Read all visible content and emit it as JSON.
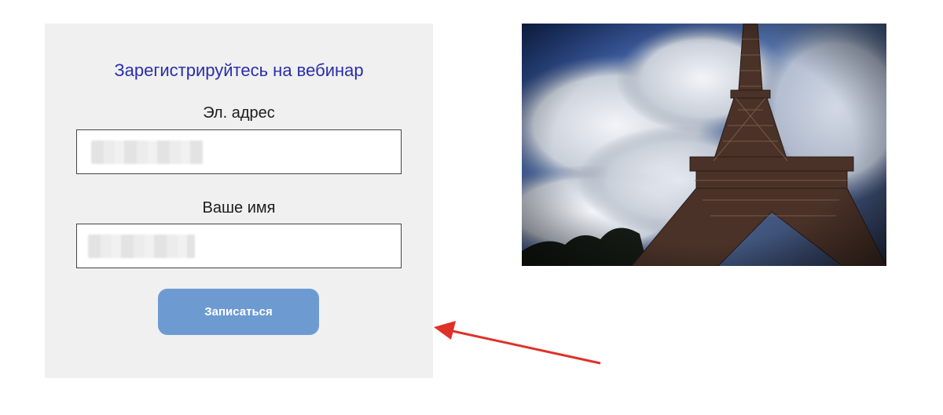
{
  "form": {
    "title": "Зарегистрируйтесь на вебинар",
    "email_label": "Эл. адрес",
    "name_label": "Ваше имя",
    "submit_label": "Записаться"
  },
  "image": {
    "subject": "eiffel-tower-photo"
  },
  "colors": {
    "title": "#2b2ea8",
    "button": "#6d9bd1",
    "panel": "#f0f0f1",
    "arrow": "#e0302a"
  }
}
